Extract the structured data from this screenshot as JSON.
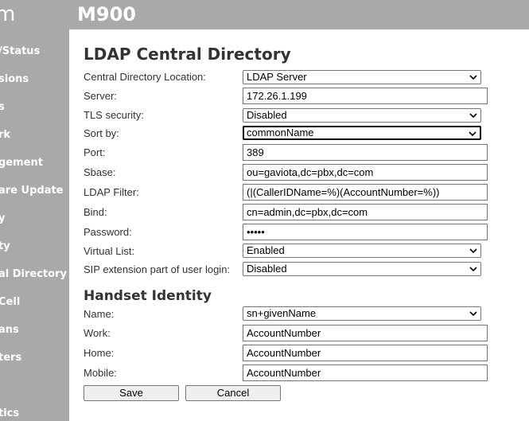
{
  "header": {
    "logo": "m",
    "model": "M900"
  },
  "sidebar": {
    "items": [
      {
        "label": "/Status"
      },
      {
        "label": "sions"
      },
      {
        "label": "s"
      },
      {
        "label": "rk"
      },
      {
        "label": "gement"
      },
      {
        "label": "are Update"
      },
      {
        "label": "y"
      },
      {
        "label": "ty"
      },
      {
        "label": "al Directory"
      },
      {
        "label": "Cell"
      },
      {
        "label": "ans"
      },
      {
        "label": "ters"
      },
      {
        "label": "tics"
      }
    ]
  },
  "page": {
    "title": "LDAP Central Directory",
    "section2_title": "Handset Identity"
  },
  "form": {
    "location": {
      "label": "Central Directory Location:",
      "value": "LDAP Server"
    },
    "server": {
      "label": "Server:",
      "value": "172.26.1.199"
    },
    "tls": {
      "label": "TLS security:",
      "value": "Disabled"
    },
    "sort": {
      "label": "Sort by:",
      "value": "commonName"
    },
    "port": {
      "label": "Port:",
      "value": "389"
    },
    "sbase": {
      "label": "Sbase:",
      "value": "ou=gaviota,dc=pbx,dc=com"
    },
    "filter": {
      "label": "LDAP Filter:",
      "value": " (|(CallerIDName=%)(AccountNumber=%))"
    },
    "bind": {
      "label": "Bind:",
      "value": "cn=admin,dc=pbx,dc=com"
    },
    "password": {
      "label": "Password:",
      "value": "•••••"
    },
    "virtual_list": {
      "label": "Virtual List:",
      "value": "Enabled"
    },
    "sip_ext": {
      "label": "SIP extension part of user login:",
      "value": "Disabled"
    }
  },
  "handset": {
    "name": {
      "label": "Name:",
      "value": "sn+givenName"
    },
    "work": {
      "label": "Work:",
      "value": "AccountNumber"
    },
    "home": {
      "label": "Home:",
      "value": "AccountNumber"
    },
    "mobile": {
      "label": "Mobile:",
      "value": "AccountNumber"
    }
  },
  "buttons": {
    "save": "Save",
    "cancel": "Cancel"
  },
  "colors": {
    "header_bg": "#a9a9a9",
    "sidebar_bg": "#a9a9a9",
    "text": "#333333"
  }
}
